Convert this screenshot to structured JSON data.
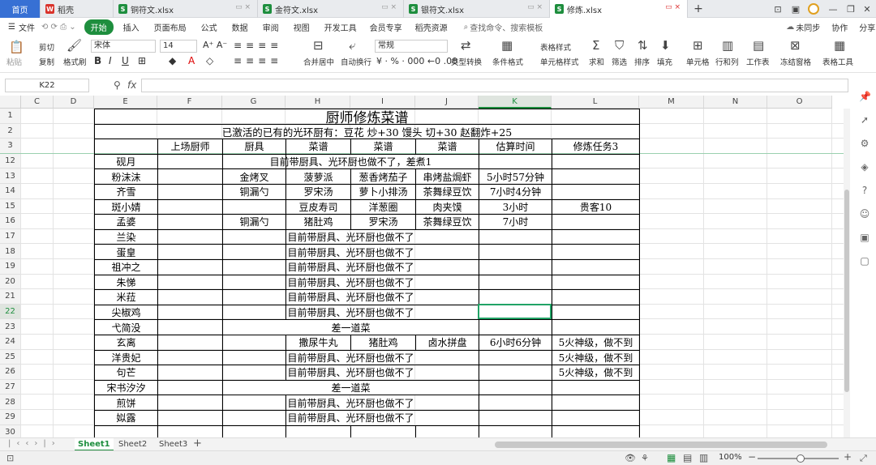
{
  "tabs": [
    {
      "label": "首页",
      "icon": ""
    },
    {
      "label": "稻壳",
      "icon": "wps-icon"
    },
    {
      "label": "铜符文.xlsx",
      "icon": "sheet-icon"
    },
    {
      "label": "金符文.xlsx",
      "icon": "sheet-icon"
    },
    {
      "label": "银符文.xlsx",
      "icon": "sheet-icon"
    },
    {
      "label": "修炼.xlsx",
      "icon": "sheet-icon"
    }
  ],
  "menu": {
    "file": "文件",
    "items": [
      "开始",
      "插入",
      "页面布局",
      "公式",
      "数据",
      "审阅",
      "视图",
      "开发工具",
      "会员专享",
      "稻壳资源"
    ],
    "search": "查找命令、搜索模板",
    "unsync": "未同步",
    "collab": "协作",
    "share": "分享"
  },
  "toolbar": {
    "paste": "粘贴",
    "cut": "剪切",
    "copy": "复制",
    "format_painter": "格式刷",
    "font": "宋体",
    "size": "14",
    "merge": "合并居中",
    "wrap": "自动换行",
    "numfmt": "常规",
    "convert": "类型转换",
    "cond": "条件格式",
    "table_style": "表格样式",
    "cell_style": "单元格样式",
    "sum": "求和",
    "filter": "筛选",
    "sort": "排序",
    "fill": "填充",
    "cell": "单元格",
    "rowcol": "行和列",
    "worksheet": "工作表",
    "freeze": "冻结窗格",
    "table_tools": "表格工具"
  },
  "formula_bar": {
    "cell_ref": "K22",
    "fx": "fx",
    "content": ""
  },
  "columns": [
    "C",
    "D",
    "E",
    "F",
    "G",
    "H",
    "I",
    "J",
    "K",
    "L",
    "M",
    "N",
    "O"
  ],
  "rows": [
    "1",
    "2",
    "3",
    "12",
    "13",
    "14",
    "15",
    "16",
    "17",
    "18",
    "19",
    "20",
    "21",
    "22",
    "23",
    "24",
    "25",
    "26",
    "27",
    "28",
    "29",
    "30"
  ],
  "sheet": {
    "title": "厨师修炼菜谱",
    "subtitle": "已激活的已有的光环厨有：豆花 炒+30 馒头 切+30 赵翻炸+25",
    "headers": [
      "上场厨师",
      "厨具",
      "菜谱",
      "菜谱",
      "菜谱",
      "估算时间",
      "修炼任务3"
    ],
    "chefs": [
      "砚月",
      "粉沫沫",
      "齐雪",
      "斑小婧",
      "孟婆",
      "兰染",
      "蛋皇",
      "祖冲之",
      "朱悌",
      "米菈",
      "尖椒鸡",
      "弋简没",
      "玄离",
      "洋贵妃",
      "句芒",
      "宋书汐汐",
      "煎饼",
      "姒露"
    ],
    "merged": {
      "r12": "目前带厨具、光环厨也做不了，差煮1",
      "cannot": "目前带厨具、光环厨也做不了",
      "missing": "差一道菜"
    },
    "r13": {
      "tool": "金烤叉",
      "d1": "菠萝派",
      "d2": "葱香烤茄子",
      "d3": "串烤盐焗虾",
      "time": "5小时57分钟"
    },
    "r14": {
      "tool": "铜漏勺",
      "d1": "罗宋汤",
      "d2": "萝卜小排汤",
      "d3": "茶舞绿豆饮",
      "time": "7小时4分钟"
    },
    "r15": {
      "d1": "豆皮寿司",
      "d2": "洋葱圈",
      "d3": "肉夹馍",
      "time": "3小时",
      "task": "贵客10"
    },
    "r16": {
      "tool": "铜漏勺",
      "d1": "猪肚鸡",
      "d2": "罗宋汤",
      "d3": "茶舞绿豆饮",
      "time": "7小时"
    },
    "r24": {
      "d1": "撒尿牛丸",
      "d2": "猪肚鸡",
      "d3": "卤水拼盘",
      "time": "6小时6分钟",
      "task": "5火神级，做不到"
    },
    "r25_task": "5火神级，做不到",
    "r26_task": "5火神级，做不到"
  },
  "sheet_tabs": [
    "Sheet1",
    "Sheet2",
    "Sheet3"
  ],
  "status": {
    "zoom": "100%"
  },
  "colors": {
    "accent": "#1e8e3e",
    "selection": "#21a366",
    "tab_active": "#ffffff",
    "header_bg": "#f3f3f3"
  }
}
